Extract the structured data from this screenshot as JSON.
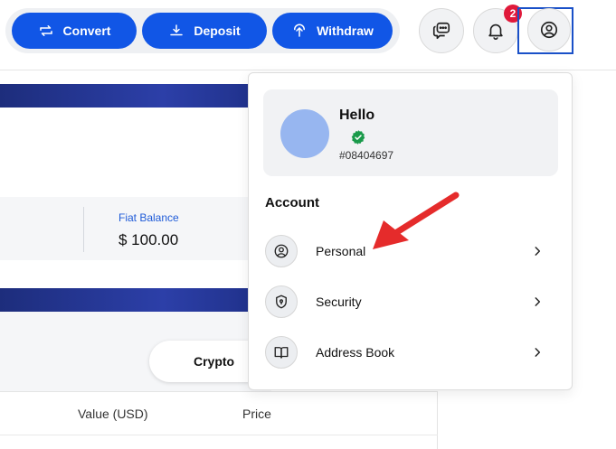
{
  "toolbar": {
    "convert_label": "Convert",
    "deposit_label": "Deposit",
    "withdraw_label": "Withdraw",
    "notification_count": "2"
  },
  "balances": {
    "fiat_label": "Fiat Balance",
    "fiat_value": "$ 100.00"
  },
  "tabs": {
    "crypto_label": "Crypto"
  },
  "table": {
    "columns": [
      "Value (USD)",
      "Price"
    ]
  },
  "profile_menu": {
    "greeting": "Hello",
    "user_id": "#08404697",
    "section_title": "Account",
    "items": [
      {
        "label": "Personal",
        "icon": "user-icon"
      },
      {
        "label": "Security",
        "icon": "shield-icon"
      },
      {
        "label": "Address Book",
        "icon": "book-icon"
      }
    ]
  },
  "colors": {
    "primary": "#1156e6",
    "badge": "#e0193a",
    "avatar": "#97b6f0",
    "verified": "#1a9a4a",
    "annotation": "#e52b2b"
  }
}
